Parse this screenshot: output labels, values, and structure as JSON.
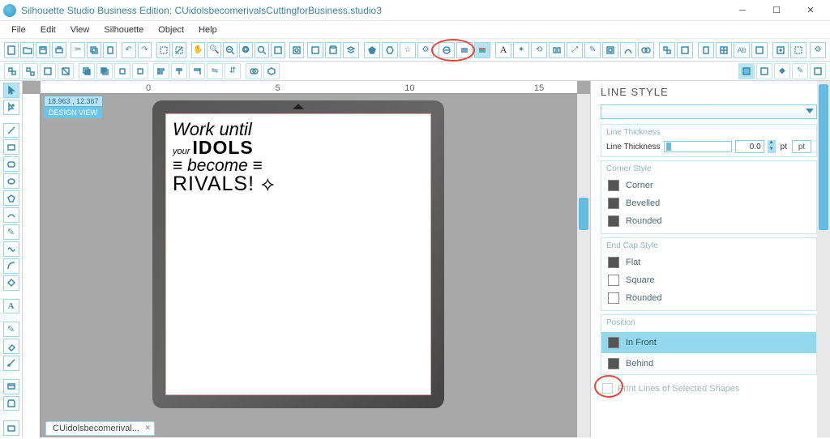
{
  "app": {
    "title": "Silhouette Studio Business Edition: CUidolsbecomerivalsCuttingforBusiness.studio3"
  },
  "menu": {
    "file": "File",
    "edit": "Edit",
    "view": "View",
    "silhouette": "Silhouette",
    "object": "Object",
    "help": "Help"
  },
  "coords": "18.963 , 12.367",
  "design_view": "DESIGN VIEW",
  "artwork": {
    "l1": "Work until",
    "l2a": "your ",
    "l2b": "IDOLS",
    "l3": "≡ become ≡",
    "l4": "RIVALS! ⟡"
  },
  "tab": "CUidolsbecomerival...",
  "panel": {
    "title": "LINE STYLE",
    "sections": {
      "thickness": {
        "head": "Line Thickness",
        "label": "Line Thickness",
        "value": "0.0",
        "unit": "pt",
        "unit_btn": "pt"
      },
      "corner": {
        "head": "Corner Style",
        "opts": [
          "Corner",
          "Bevelled",
          "Rounded"
        ]
      },
      "endcap": {
        "head": "End Cap Style",
        "opts": [
          "Flat",
          "Square",
          "Rounded"
        ]
      },
      "position": {
        "head": "Position",
        "opts": [
          "In Front",
          "Behind"
        ],
        "selected": 0
      },
      "print_lines": "Print Lines of Selected Shapes"
    }
  },
  "ruler": {
    "marks": [
      "0",
      "5",
      "10",
      "15"
    ]
  }
}
